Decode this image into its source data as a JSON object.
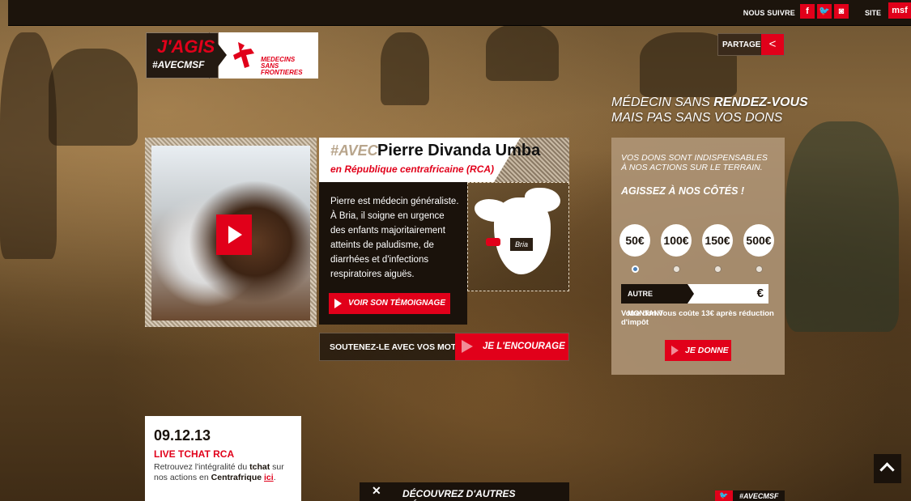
{
  "topbar": {
    "follow_label": "NOUS SUIVRE",
    "social": [
      "f",
      "t",
      "o"
    ],
    "site_label": "SITE",
    "msf_label": "msf"
  },
  "logo": {
    "jagis": "J'AGIS",
    "hashtag": "#AVECMSF",
    "org_line1": "MEDECINS",
    "org_line2": "SANS FRONTIERES"
  },
  "share": {
    "label": "PARTAGER"
  },
  "tagline": {
    "line1_regular": "MÉDECIN SANS ",
    "line1_bold": "RENDEZ-VOUS",
    "line2": "MAIS PAS SANS VOS DONS"
  },
  "profile": {
    "avec": "#AVEC",
    "name": "Pierre Divanda Umba",
    "location": "en République centrafricaine (RCA)",
    "bio": "Pierre est médecin généraliste. À Bria, il soigne en urgence des enfants majoritairement atteints de paludisme, de diarrhées et d'infections respiratoires aiguës.",
    "cta": "VOIR SON TÉMOIGNAGE",
    "map_label": "Bria"
  },
  "encourage": {
    "label": "SOUTENEZ-LE AVEC VOS MOTS",
    "button": "JE L'ENCOURAGE"
  },
  "donate": {
    "intro_line1": "VOS DONS SONT INDISPENSABLES",
    "intro_line2": "À NOS ACTIONS SUR LE TERRAIN.",
    "act": "AGISSEZ À NOS CÔTÉS !",
    "amounts": [
      "50€",
      "100€",
      "150€",
      "500€"
    ],
    "selected_index": 0,
    "other_label": "AUTRE MONTANT",
    "currency": "€",
    "note": "Votre don vous coûte 13€ après réduction d'impôt",
    "give": "JE DONNE"
  },
  "live": {
    "date": "09.12.13",
    "title": "LIVE TCHAT RCA",
    "body_1": "Retrouvez l'intégralité du ",
    "body_bold1": "tchat",
    "body_2": " sur nos actions en ",
    "body_bold2": "Centrafrique",
    "body_link": "ici",
    "body_end": "."
  },
  "bottom": {
    "discover": "DÉCOUVREZ D'AUTRES MÉDECINS",
    "twitter_tag": "#AVECMSF"
  },
  "colors": {
    "accent": "#e1001a",
    "dark": "#1a120b",
    "panel": "#b0967a"
  }
}
